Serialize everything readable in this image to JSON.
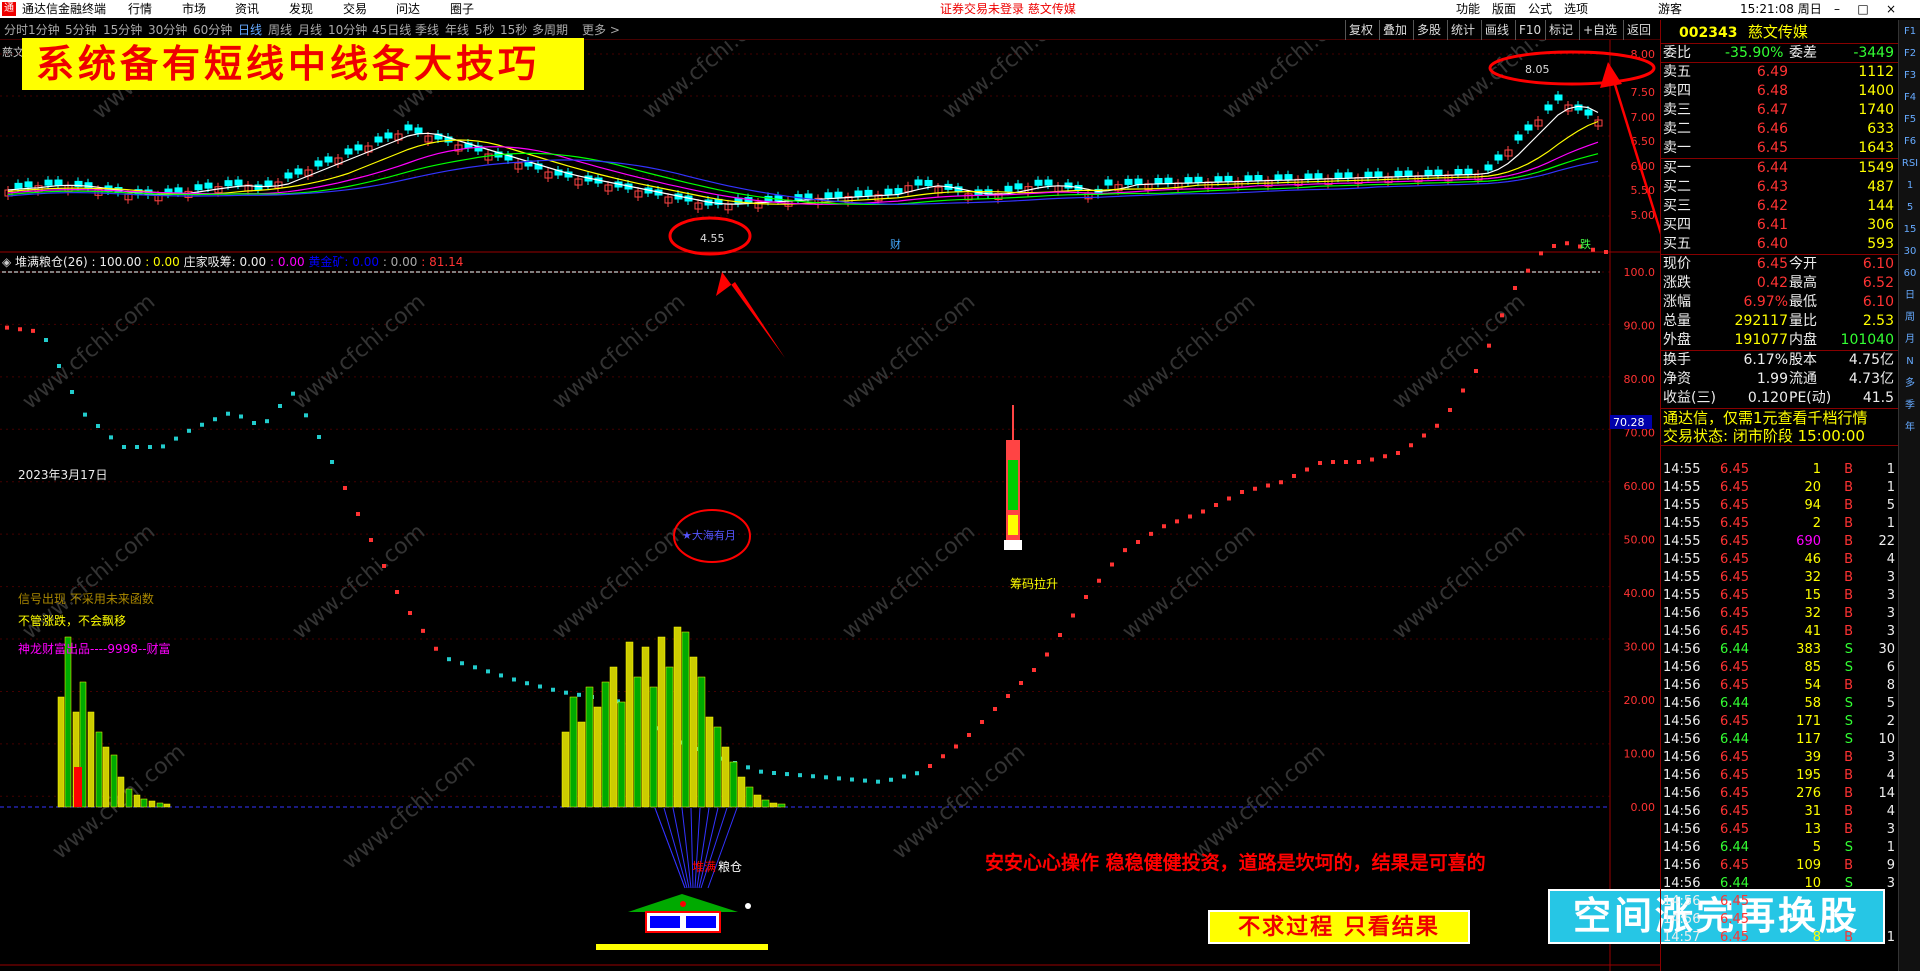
{
  "menubar": {
    "app": "通达信金融终端",
    "menus": [
      "行情",
      "市场",
      "资讯",
      "发现",
      "交易",
      "问达",
      "圈子"
    ],
    "notice": "证券交易未登录  慈文传媒",
    "right_menus": [
      "功能",
      "版面",
      "公式",
      "选项"
    ],
    "user": "游客",
    "clock": "15:21:08 周日"
  },
  "periods": [
    "分时",
    "1分钟",
    "5分钟",
    "15分钟",
    "30分钟",
    "60分钟",
    "日线",
    "周线",
    "月线",
    "10分钟",
    "45日线",
    "季线",
    "年线",
    "5秒",
    "15秒",
    "多周期",
    "更多 >"
  ],
  "tools": [
    "复权",
    "叠加",
    "多股",
    "统计",
    "画线",
    "F10",
    "标记",
    "+自选",
    "返回"
  ],
  "banner": "系统备有短线中线各大技巧",
  "stock_abbr": "慈文",
  "top_chart": {
    "price_ticks": [
      "8.00",
      "7.50",
      "7.00",
      "6.50",
      "6.00",
      "5.50",
      "5.00"
    ],
    "high_label": "8.05",
    "low_label": "4.55",
    "mark_cai": "财",
    "mark_jie": "跌"
  },
  "indicator": {
    "name": "堆满粮仓(26)",
    "v1": ": 100.00",
    "v2": ": 0.00",
    "v3": "庄家吸筹: 0.00",
    "v4": ": 0.00",
    "v5": "黄金矿: 0.00",
    "v6": ": 0.00",
    "v7": ": 81.14"
  },
  "lower_ticks": [
    "100.0",
    "90.00",
    "80.00",
    "70.00",
    "60.00",
    "50.00",
    "40.00",
    "30.00",
    "20.00",
    "10.00",
    "0.00"
  ],
  "current_value": "70.28",
  "date_label": "2023年3月17日",
  "signals": {
    "s1": "信号出现  不采用未来函数",
    "s2": "不管涨跌，不会飘移",
    "s3": "神龙财富出品----9998--财富",
    "circle_text": "★大海有月",
    "chip": "筹码拉升",
    "barn_red": "堆满",
    "barn_white": "粮仓"
  },
  "slogan": "安安心心操作   稳稳健健投资，道路是坎坷的，结果是可喜的",
  "box1": "不求过程   只看结果",
  "box2": "空间涨完再换股",
  "quote": {
    "code": "002343",
    "name": "慈文传媒",
    "wb": {
      "label": "委比",
      "pct": "-35.90%",
      "label2": "委差",
      "val": "-3449"
    },
    "asks": [
      {
        "l": "卖五",
        "p": "6.49",
        "v": "1112"
      },
      {
        "l": "卖四",
        "p": "6.48",
        "v": "1400"
      },
      {
        "l": "卖三",
        "p": "6.47",
        "v": "1740"
      },
      {
        "l": "卖二",
        "p": "6.46",
        "v": "633"
      },
      {
        "l": "卖一",
        "p": "6.45",
        "v": "1643"
      }
    ],
    "bids": [
      {
        "l": "买一",
        "p": "6.44",
        "v": "1549"
      },
      {
        "l": "买二",
        "p": "6.43",
        "v": "487"
      },
      {
        "l": "买三",
        "p": "6.42",
        "v": "144"
      },
      {
        "l": "买四",
        "p": "6.41",
        "v": "306"
      },
      {
        "l": "买五",
        "p": "6.40",
        "v": "593"
      }
    ],
    "stats": [
      {
        "a": "现价",
        "b": "6.45",
        "c": "今开",
        "d": "6.10"
      },
      {
        "a": "涨跌",
        "b": "0.42",
        "c": "最高",
        "d": "6.52"
      },
      {
        "a": "涨幅",
        "b": "6.97%",
        "c": "最低",
        "d": "6.10"
      },
      {
        "a": "总量",
        "b": "292117",
        "c": "量比",
        "d": "2.53"
      },
      {
        "a": "外盘",
        "b": "191077",
        "c": "内盘",
        "d": "101040"
      }
    ],
    "stats2": [
      {
        "a": "换手",
        "b": "6.17%",
        "c": "股本",
        "d": "4.75亿"
      },
      {
        "a": "净资",
        "b": "1.99",
        "c": "流通",
        "d": "4.73亿"
      },
      {
        "a": "收益(三)",
        "b": "0.120",
        "c": "PE(动)",
        "d": "41.5"
      }
    ],
    "promo": "通达信，仅需1元查看千档行情",
    "status": "交易状态: 闭市阶段 15:00:00",
    "ticks": [
      [
        "14:55",
        "6.45",
        "1",
        "B",
        "1"
      ],
      [
        "14:55",
        "6.45",
        "20",
        "B",
        "1"
      ],
      [
        "14:55",
        "6.45",
        "94",
        "B",
        "5"
      ],
      [
        "14:55",
        "6.45",
        "2",
        "B",
        "1"
      ],
      [
        "14:55",
        "6.45",
        "690",
        "B",
        "22"
      ],
      [
        "14:55",
        "6.45",
        "46",
        "B",
        "4"
      ],
      [
        "14:55",
        "6.45",
        "32",
        "B",
        "3"
      ],
      [
        "14:55",
        "6.45",
        "15",
        "B",
        "3"
      ],
      [
        "14:56",
        "6.45",
        "32",
        "B",
        "3"
      ],
      [
        "14:56",
        "6.45",
        "41",
        "B",
        "3"
      ],
      [
        "14:56",
        "6.44",
        "383",
        "S",
        "30"
      ],
      [
        "14:56",
        "6.45",
        "85",
        "S",
        "6"
      ],
      [
        "14:56",
        "6.45",
        "54",
        "B",
        "8"
      ],
      [
        "14:56",
        "6.44",
        "58",
        "S",
        "5"
      ],
      [
        "14:56",
        "6.45",
        "171",
        "S",
        "2"
      ],
      [
        "14:56",
        "6.44",
        "117",
        "S",
        "10"
      ],
      [
        "14:56",
        "6.45",
        "39",
        "B",
        "3"
      ],
      [
        "14:56",
        "6.45",
        "195",
        "B",
        "4"
      ],
      [
        "14:56",
        "6.45",
        "276",
        "B",
        "14"
      ],
      [
        "14:56",
        "6.45",
        "31",
        "B",
        "4"
      ],
      [
        "14:56",
        "6.45",
        "13",
        "B",
        "3"
      ],
      [
        "14:56",
        "6.44",
        "5",
        "S",
        "1"
      ],
      [
        "14:56",
        "6.45",
        "109",
        "B",
        "9"
      ],
      [
        "14:56",
        "6.44",
        "10",
        "S",
        "3"
      ],
      [
        "14:56",
        "6.45",
        "",
        "",
        ""
      ],
      [
        "14:56",
        "6.45",
        "",
        "",
        ""
      ],
      [
        "14:57",
        "6.45",
        "8",
        "B",
        "1"
      ]
    ]
  },
  "side_icons": [
    "F1",
    "F2",
    "F3",
    "F4",
    "F5",
    "F6",
    "RSI",
    "1",
    "5",
    "15",
    "30",
    "60",
    "日",
    "周",
    "月",
    "N",
    "多",
    "季",
    "年"
  ]
}
